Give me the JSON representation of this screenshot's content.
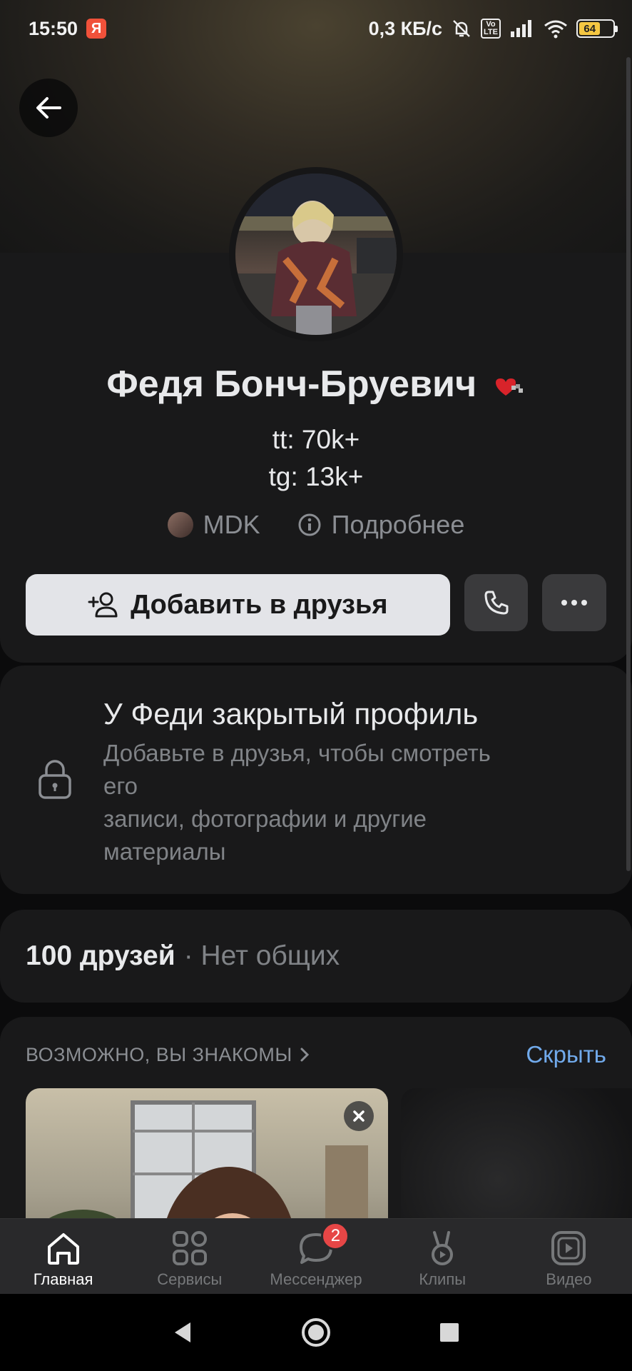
{
  "status_bar": {
    "time": "15:50",
    "ya_badge": "Я",
    "network_speed": "0,3 КБ/с",
    "lte_label": "Vo\nLTE",
    "battery": "64"
  },
  "profile": {
    "name": "Федя Бонч-Бруевич",
    "bio_lines": [
      "tt: 70k+",
      "tg: 13k+"
    ],
    "work_place": "MDK",
    "more_link": "Подробнее"
  },
  "actions": {
    "add_friend_label": "Добавить в друзья"
  },
  "closed_profile": {
    "title": "У Феди закрытый профиль",
    "line1": "Добавьте в друзья, чтобы смотреть",
    "line2": "его",
    "line3": "записи, фотографии и другие",
    "line4": "материалы"
  },
  "friends": {
    "count_label": "100 друзей",
    "common_label": "· Нет общих"
  },
  "suggestions": {
    "title": "ВОЗМОЖНО, ВЫ ЗНАКОМЫ",
    "hide_label": "Скрыть"
  },
  "tabbar": {
    "items": [
      {
        "label": "Главная",
        "icon": "home-icon",
        "active": true
      },
      {
        "label": "Сервисы",
        "icon": "services-icon"
      },
      {
        "label": "Мессенджер",
        "icon": "messenger-icon",
        "badge": "2"
      },
      {
        "label": "Клипы",
        "icon": "clips-icon"
      },
      {
        "label": "Видео",
        "icon": "video-icon"
      }
    ]
  },
  "colors": {
    "accent_link": "#71aaeb",
    "badge": "#e64646",
    "battery": "#f5c742",
    "card": "#19191a"
  }
}
